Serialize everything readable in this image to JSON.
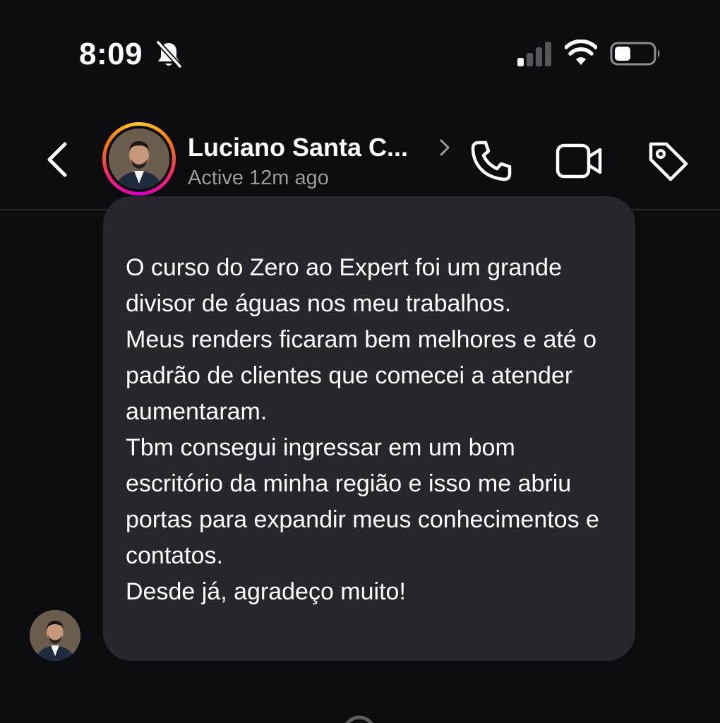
{
  "status_bar": {
    "time": "8:09",
    "icons": [
      "bell-slash-icon",
      "cellular-signal-icon",
      "wifi-icon",
      "battery-icon"
    ]
  },
  "header": {
    "back_icon": "chevron-left-icon",
    "contact_name": "Luciano Santa C...",
    "contact_status": "Active 12m ago",
    "actions": [
      "phone-icon",
      "video-camera-icon",
      "tag-icon"
    ]
  },
  "message": {
    "paragraphs": [
      "O curso do Zero ao Expert foi um grande divisor de águas nos meu trabalhos.",
      "Meus renders ficaram bem melhores e até o padrão de clientes que comecei a atender aumentaram.",
      "Tbm consegui ingressar em um bom escritório da minha região e isso me abriu portas para expandir meus conhecimentos e contatos.",
      "Desde já, agradeço muito!"
    ]
  },
  "colors": {
    "background": "#0b0c10",
    "bubble": "#26272c",
    "secondary_text": "#9a9ba0",
    "story_ring": [
      "#ffcc33",
      "#ff7a00",
      "#ff1f6b",
      "#d300c5"
    ]
  }
}
